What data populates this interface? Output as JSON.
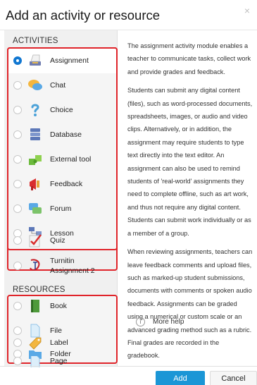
{
  "dialog": {
    "title": "Add an activity or resource",
    "close_label": "×"
  },
  "activities": {
    "header": "ACTIVITIES",
    "items": [
      {
        "label": "Assignment",
        "icon": "assignment-icon",
        "selected": true
      },
      {
        "label": "Chat",
        "icon": "chat-icon",
        "selected": false
      },
      {
        "label": "Choice",
        "icon": "choice-icon",
        "selected": false
      },
      {
        "label": "Database",
        "icon": "database-icon",
        "selected": false
      },
      {
        "label": "External tool",
        "icon": "external-tool-icon",
        "selected": false
      },
      {
        "label": "Feedback",
        "icon": "feedback-icon",
        "selected": false
      },
      {
        "label": "Forum",
        "icon": "forum-icon",
        "selected": false
      },
      {
        "label": "Lesson",
        "icon": "lesson-icon",
        "selected": false
      },
      {
        "label": "Quiz",
        "icon": "quiz-icon",
        "selected": false
      },
      {
        "label": "Turnitin",
        "label2": "Assignment 2",
        "icon": "turnitin-icon",
        "selected": false
      }
    ]
  },
  "resources": {
    "header": "RESOURCES",
    "items": [
      {
        "label": "Book",
        "icon": "book-icon"
      },
      {
        "label": "File",
        "icon": "file-icon"
      },
      {
        "label": "Folder",
        "icon": "folder-icon"
      },
      {
        "label": "Label",
        "icon": "label-icon"
      },
      {
        "label": "Page",
        "icon": "page-icon"
      }
    ]
  },
  "description": {
    "p1": "The assignment activity module enables a teacher to communicate tasks, collect work and provide grades and feedback.",
    "p2": "Students can submit any digital content (files), such as word-processed documents, spreadsheets, images, or audio and video clips. Alternatively, or in addition, the assignment may require students to type text directly into the text editor. An assignment can also be used to remind students of 'real-world' assignments they need to complete offline, such as art work, and thus not require any digital content. Students can submit work individually or as a member of a group.",
    "p3": "When reviewing assignments, teachers can leave feedback comments and upload files, such as marked-up student submissions, documents with comments or spoken audio feedback. Assignments can be graded using a numerical or custom scale or an advanced grading method such as a rubric. Final grades are recorded in the gradebook.",
    "more_help": "More help",
    "help_icon_glyph": "i"
  },
  "footer": {
    "add_label": "Add",
    "cancel_label": "Cancel"
  },
  "colors": {
    "highlight_border": "#e0242a",
    "primary_button": "#1b96d6",
    "radio_checked": "#1177d1"
  }
}
